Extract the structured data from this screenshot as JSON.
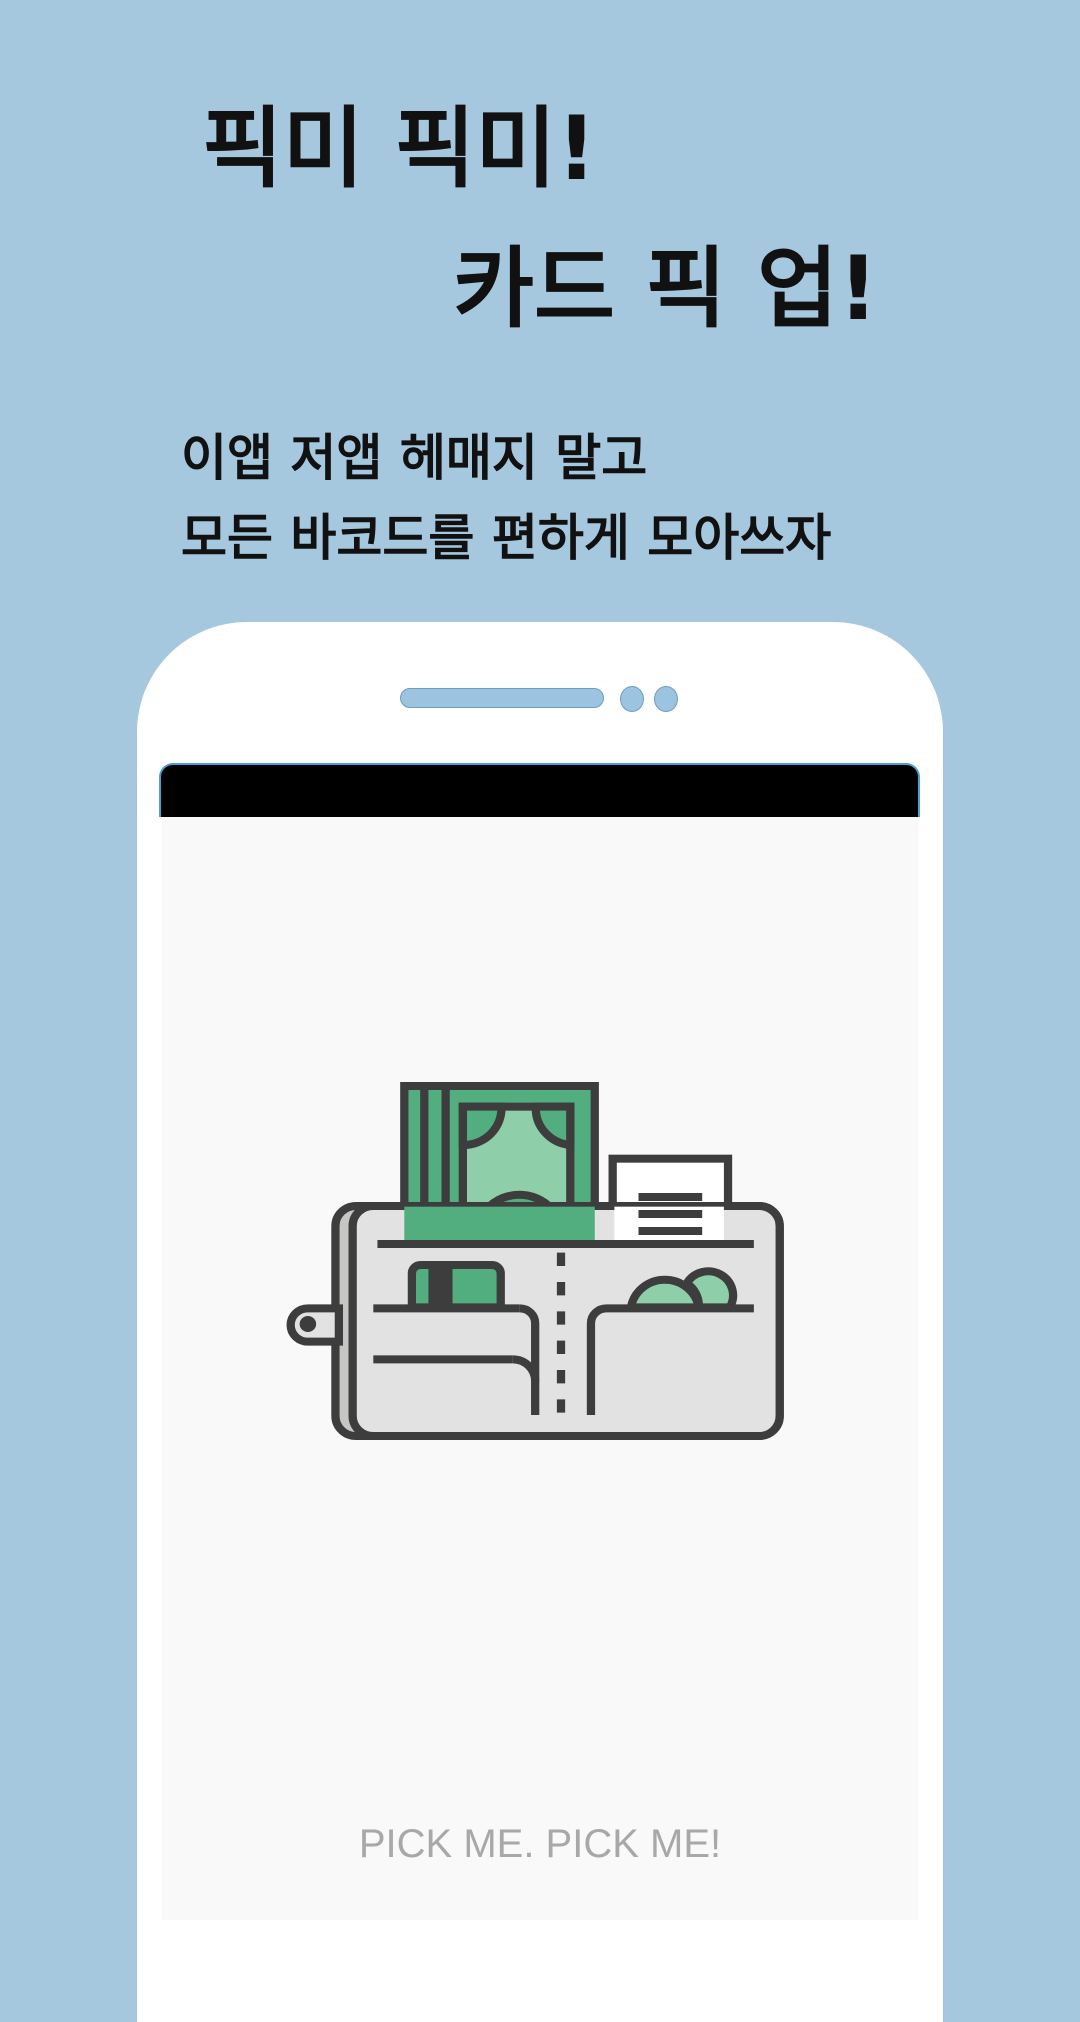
{
  "headline": {
    "line1": "픽미 픽미!",
    "line2": "카드 픽 업!"
  },
  "subtitle": {
    "line1": "이앱 저앱 헤매지 말고",
    "line2": "모든 바코드를 편하게 모아쓰자"
  },
  "app_screen": {
    "illustration": "wallet-icon",
    "footer_text": "PICK ME. PICK ME!"
  },
  "colors": {
    "background": "#a6c8df",
    "green_dark": "#52ae7f",
    "green_light": "#8ecfa9",
    "outline": "#3d3d3d"
  }
}
